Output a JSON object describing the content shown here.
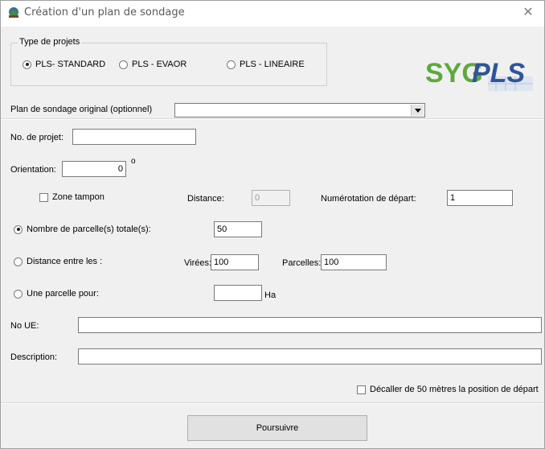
{
  "window": {
    "title": "Création d'un plan de sondage",
    "close_glyph": "✕"
  },
  "project_type": {
    "group_label": "Type de projets",
    "options": [
      {
        "label": "PLS- STANDARD",
        "selected": true
      },
      {
        "label": "PLS - EVAOR",
        "selected": false
      },
      {
        "label": "PLS - LINEAIRE",
        "selected": false
      }
    ]
  },
  "logo": {
    "text_main": "SYG",
    "text_accent": "PLS",
    "colors": {
      "syg": "#5fa83c",
      "pls": "#2f5597"
    }
  },
  "original_plan": {
    "label": "Plan de sondage original (optionnel)",
    "value": ""
  },
  "project_no": {
    "label": "No. de projet:",
    "value": ""
  },
  "orientation": {
    "label": "Orientation:",
    "value": "0",
    "unit": "o"
  },
  "buffer": {
    "checkbox_label": "Zone tampon",
    "checked": false,
    "distance_label": "Distance:",
    "distance_value": "0",
    "numbering_label": "Numérotation de départ:",
    "numbering_value": "1"
  },
  "mode": {
    "total_plots": {
      "label": "Nombre de parcelle(s) totale(s):",
      "selected": true,
      "value": "50"
    },
    "distance_between": {
      "label": "Distance entre les :",
      "selected": false,
      "virees_label": "Virées:",
      "virees_value": "100",
      "parcelles_label": "Parcelles:",
      "parcelles_value": "100"
    },
    "one_plot_per": {
      "label": "Une parcelle pour:",
      "selected": false,
      "value": "",
      "unit": "Ha"
    }
  },
  "no_ue": {
    "label": "No UE:",
    "value": ""
  },
  "description": {
    "label": "Description:",
    "value": ""
  },
  "offset": {
    "label": "Décaller de 50 mètres la position de départ",
    "checked": false
  },
  "continue_button": {
    "label": "Poursuivre"
  }
}
